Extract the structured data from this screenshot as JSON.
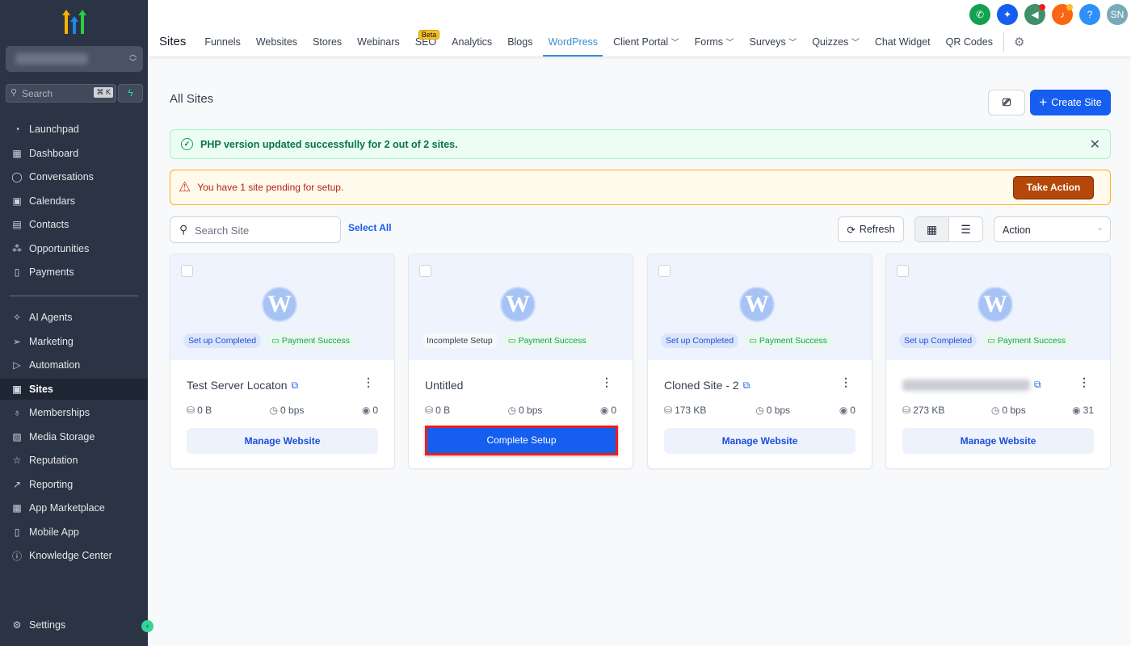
{
  "sidebar": {
    "search_placeholder": "Search",
    "shortcut": "⌘ K",
    "settings": "Settings",
    "items": [
      {
        "label": "Launchpad",
        "icon": "launchpad-icon",
        "glyph": "◔"
      },
      {
        "label": "Dashboard",
        "icon": "dashboard-icon",
        "glyph": "▦"
      },
      {
        "label": "Conversations",
        "icon": "chat-icon",
        "glyph": "◯"
      },
      {
        "label": "Calendars",
        "icon": "calendar-icon",
        "glyph": "▣"
      },
      {
        "label": "Contacts",
        "icon": "contacts-icon",
        "glyph": "▤"
      },
      {
        "label": "Opportunities",
        "icon": "opportunities-icon",
        "glyph": "⁂"
      },
      {
        "label": "Payments",
        "icon": "payments-icon",
        "glyph": "▯"
      },
      {
        "label": "AI Agents",
        "icon": "ai-agents-icon",
        "glyph": "✧"
      },
      {
        "label": "Marketing",
        "icon": "send-icon",
        "glyph": "➢"
      },
      {
        "label": "Automation",
        "icon": "automation-icon",
        "glyph": "▷"
      },
      {
        "label": "Sites",
        "icon": "sites-icon",
        "glyph": "▣"
      },
      {
        "label": "Memberships",
        "icon": "memberships-icon",
        "glyph": "♁"
      },
      {
        "label": "Media Storage",
        "icon": "media-icon",
        "glyph": "▨"
      },
      {
        "label": "Reputation",
        "icon": "star-icon",
        "glyph": "☆"
      },
      {
        "label": "Reporting",
        "icon": "trend-icon",
        "glyph": "↗"
      },
      {
        "label": "App Marketplace",
        "icon": "apps-icon",
        "glyph": "▦"
      },
      {
        "label": "Mobile App",
        "icon": "mobile-icon",
        "glyph": "▯"
      },
      {
        "label": "Knowledge Center",
        "icon": "info-icon",
        "glyph": "ⓘ"
      }
    ]
  },
  "topnav": {
    "title": "Sites",
    "beta": "Beta",
    "tabs": [
      "Funnels",
      "Websites",
      "Stores",
      "Webinars",
      "SEO",
      "Analytics",
      "Blogs",
      "WordPress",
      "Client Portal",
      "Forms",
      "Surveys",
      "Quizzes",
      "Chat Widget",
      "QR Codes"
    ],
    "active": "WordPress",
    "avatar": "SN"
  },
  "page": {
    "title": "All Sites",
    "create_label": "Create Site",
    "success_msg": "PHP version updated successfully for 2 out of 2 sites.",
    "warn_msg": "You have 1 site pending for setup.",
    "take_action": "Take Action",
    "search_placeholder": "Search Site",
    "select_all": "Select All",
    "refresh": "Refresh",
    "action": "Action"
  },
  "colors": {
    "primary": "#155eef",
    "sidebar": "#2b3444",
    "success": "#067647",
    "warning": "#b54708"
  },
  "cards": [
    {
      "name": "Test Server Locaton",
      "status": "Set up Completed",
      "payment": "Payment Success",
      "size": "0 B",
      "bandwidth": "0 bps",
      "views": "0",
      "button": "Manage Website"
    },
    {
      "name": "Untitled",
      "status": "Incomplete Setup",
      "payment": "Payment Success",
      "size": "0 B",
      "bandwidth": "0 bps",
      "views": "0",
      "button": "Complete Setup"
    },
    {
      "name": "Cloned Site - 2",
      "status": "Set up Completed",
      "payment": "Payment Success",
      "size": "173 KB",
      "bandwidth": "0 bps",
      "views": "0",
      "button": "Manage Website"
    },
    {
      "name": "",
      "status": "Set up Completed",
      "payment": "Payment Success",
      "size": "273 KB",
      "bandwidth": "0 bps",
      "views": "31",
      "button": "Manage Website"
    }
  ]
}
